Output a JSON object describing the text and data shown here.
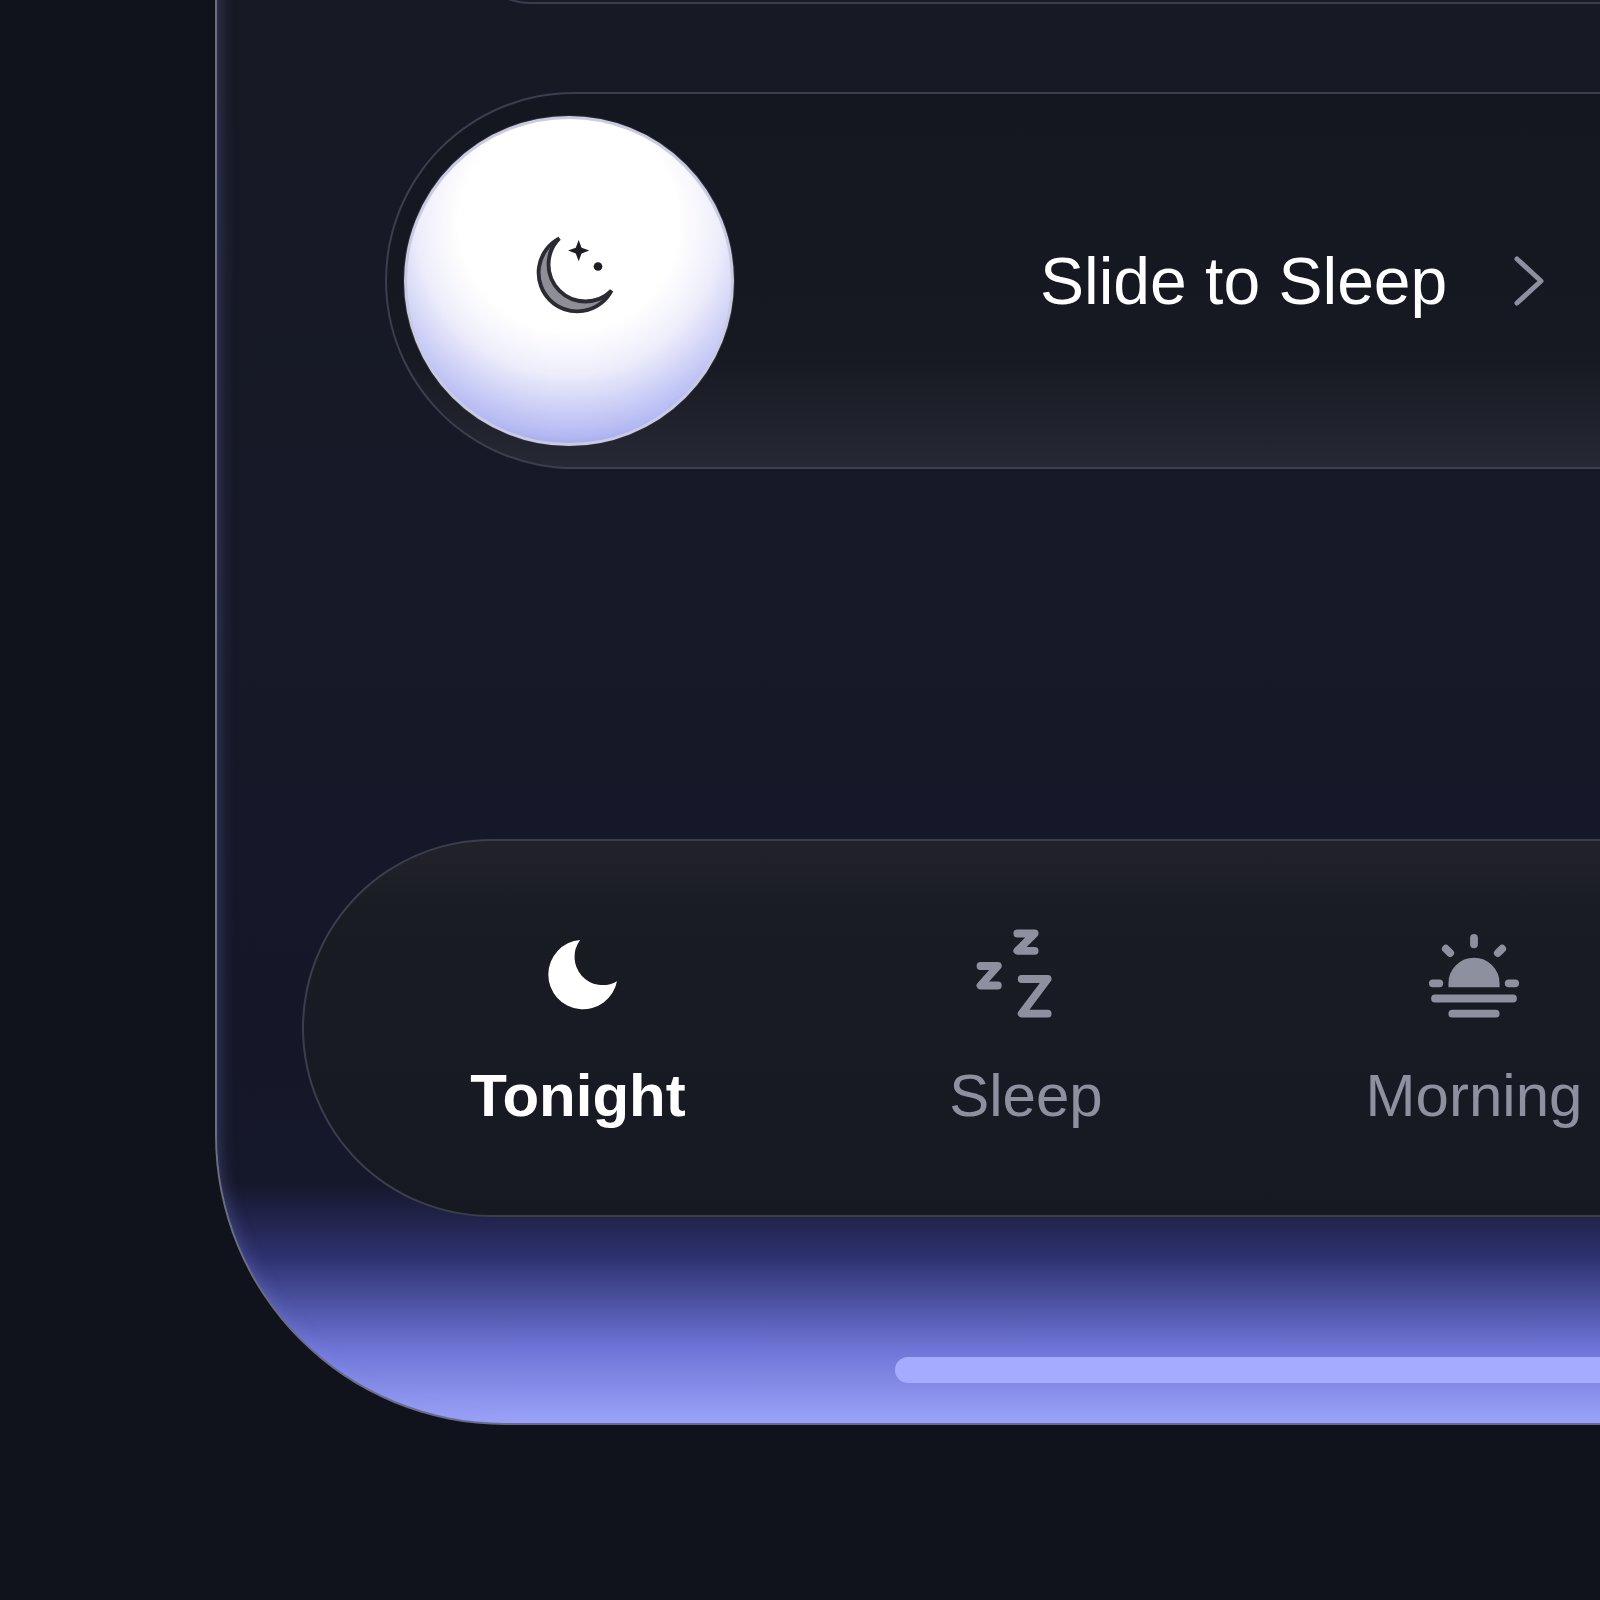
{
  "slider": {
    "label": "Slide to Sleep"
  },
  "tabs": [
    {
      "label": "Tonight",
      "selected": true
    },
    {
      "label": "Sleep",
      "selected": false
    },
    {
      "label": "Morning",
      "selected": false
    }
  ]
}
